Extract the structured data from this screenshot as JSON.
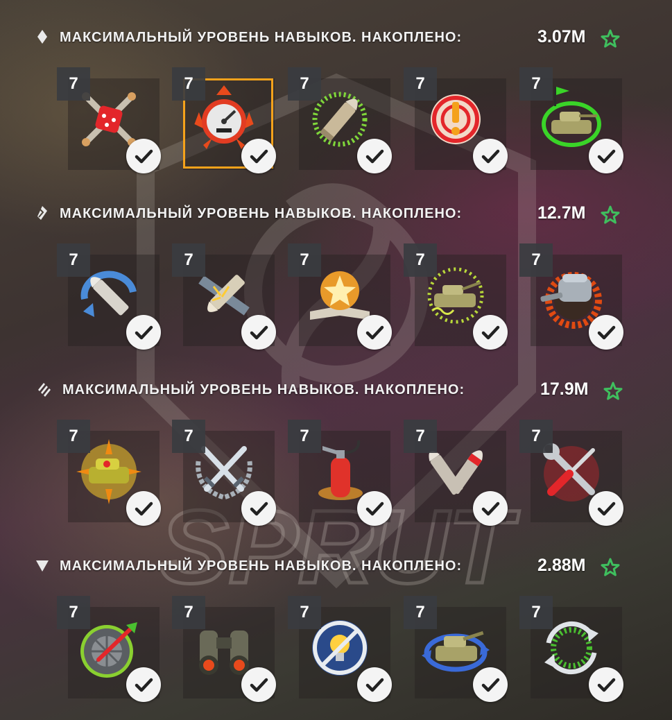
{
  "watermark": {
    "text": "SPRUT"
  },
  "colors": {
    "star": "#3fbf5e",
    "selected": "#f5a21b"
  },
  "sections": [
    {
      "rank_icon": "rank-1-diamond-icon",
      "title": "МАКСИМАЛЬНЫЙ УРОВЕНЬ НАВЫКОВ. НАКОПЛЕНО:",
      "amount": "3.07M",
      "skills": [
        {
          "level": "7",
          "icon": "dice-crossed-shells-icon",
          "checked": true
        },
        {
          "level": "7",
          "icon": "speedometer-gauge-icon",
          "checked": true,
          "selected": true
        },
        {
          "level": "7",
          "icon": "shell-green-ring-icon",
          "checked": true
        },
        {
          "level": "7",
          "icon": "target-exclamation-icon",
          "checked": true
        },
        {
          "level": "7",
          "icon": "tank-green-flag-icon",
          "checked": true
        }
      ]
    },
    {
      "rank_icon": "rank-2-chevron-icon",
      "title": "МАКСИМАЛЬНЫЙ УРОВЕНЬ НАВЫКОВ. НАКОПЛЕНО:",
      "amount": "12.7M",
      "skills": [
        {
          "level": "7",
          "icon": "shell-swirl-icon",
          "checked": true
        },
        {
          "level": "7",
          "icon": "shell-armor-pierce-icon",
          "checked": true
        },
        {
          "level": "7",
          "icon": "star-book-icon",
          "checked": true
        },
        {
          "level": "7",
          "icon": "tank-dotted-ring-icon",
          "checked": true
        },
        {
          "level": "7",
          "icon": "turret-gear-icon",
          "checked": true
        }
      ]
    },
    {
      "rank_icon": "rank-3-chevron-icon",
      "title": "МАКСИМАЛЬНЫЙ УРОВЕНЬ НАВЫКОВ. НАКОПЛЕНО:",
      "amount": "17.9M",
      "skills": [
        {
          "level": "7",
          "icon": "tank-burst-icon",
          "checked": true
        },
        {
          "level": "7",
          "icon": "crossed-swords-wreath-icon",
          "checked": true
        },
        {
          "level": "7",
          "icon": "fire-extinguisher-icon",
          "checked": true
        },
        {
          "level": "7",
          "icon": "crossed-shells-icon",
          "checked": true
        },
        {
          "level": "7",
          "icon": "wrench-screwdriver-icon",
          "checked": true
        }
      ]
    },
    {
      "rank_icon": "rank-4-triangle-icon",
      "title": "МАКСИМАЛЬНЫЙ УРОВЕНЬ НАВЫКОВ. НАКОПЛЕНО:",
      "amount": "2.88M",
      "skills": [
        {
          "level": "7",
          "icon": "wheel-dart-icon",
          "checked": true
        },
        {
          "level": "7",
          "icon": "binoculars-icon",
          "checked": true
        },
        {
          "level": "7",
          "icon": "bulb-crossed-icon",
          "checked": true
        },
        {
          "level": "7",
          "icon": "tank-arrows-icon",
          "checked": true
        },
        {
          "level": "7",
          "icon": "reload-cycle-icon",
          "checked": true
        }
      ]
    }
  ]
}
